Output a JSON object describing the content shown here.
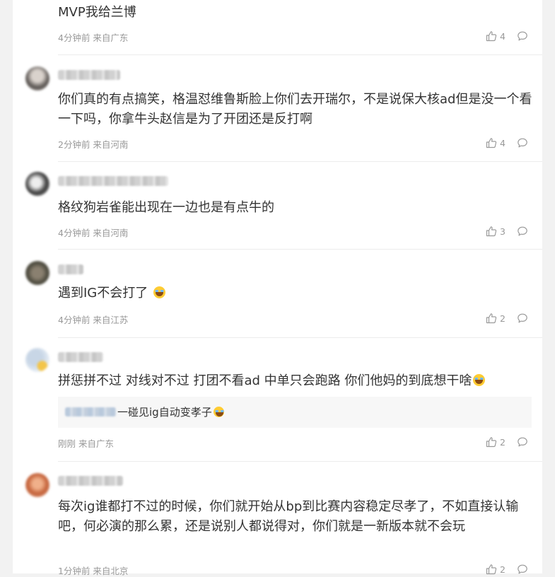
{
  "comments": [
    {
      "text": "MVP我给兰博",
      "time": "4分钟前 来自广东",
      "likes": "4"
    },
    {
      "text": "你们真的有点搞笑，格温怼维鲁斯脸上你们去开瑞尔，不是说保大核ad但是没一个看一下吗，你拿牛头赵信是为了开团还是反打啊",
      "time": "2分钟前 来自河南",
      "likes": "4"
    },
    {
      "text": "格纹狗岩雀能出现在一边也是有点牛的",
      "time": "4分钟前 来自河南",
      "likes": "3"
    },
    {
      "text": "遇到IG不会打了",
      "time": "4分钟前 来自江苏",
      "likes": "2"
    },
    {
      "text": "拼惩拼不过 对线对不过 打团不看ad 中单只会跑路 你们他妈的到底想干啥",
      "time": "刚刚 来自广东",
      "likes": "2",
      "reply_text": "一碰见ig自动变孝子"
    },
    {
      "text": "每次ig谁都打不过的时候，你们就开始从bp到比赛内容稳定尽孝了，不如直接认输吧，何必演的那么累，还是说别人都说得对，你们就是一新版本就不会玩",
      "time": "1分钟前 来自北京",
      "likes": "2"
    }
  ],
  "icons": {
    "like": "thumbs-up-icon",
    "reply": "comment-bubble-icon",
    "emoji": "grin-sweat-emoji-icon"
  }
}
